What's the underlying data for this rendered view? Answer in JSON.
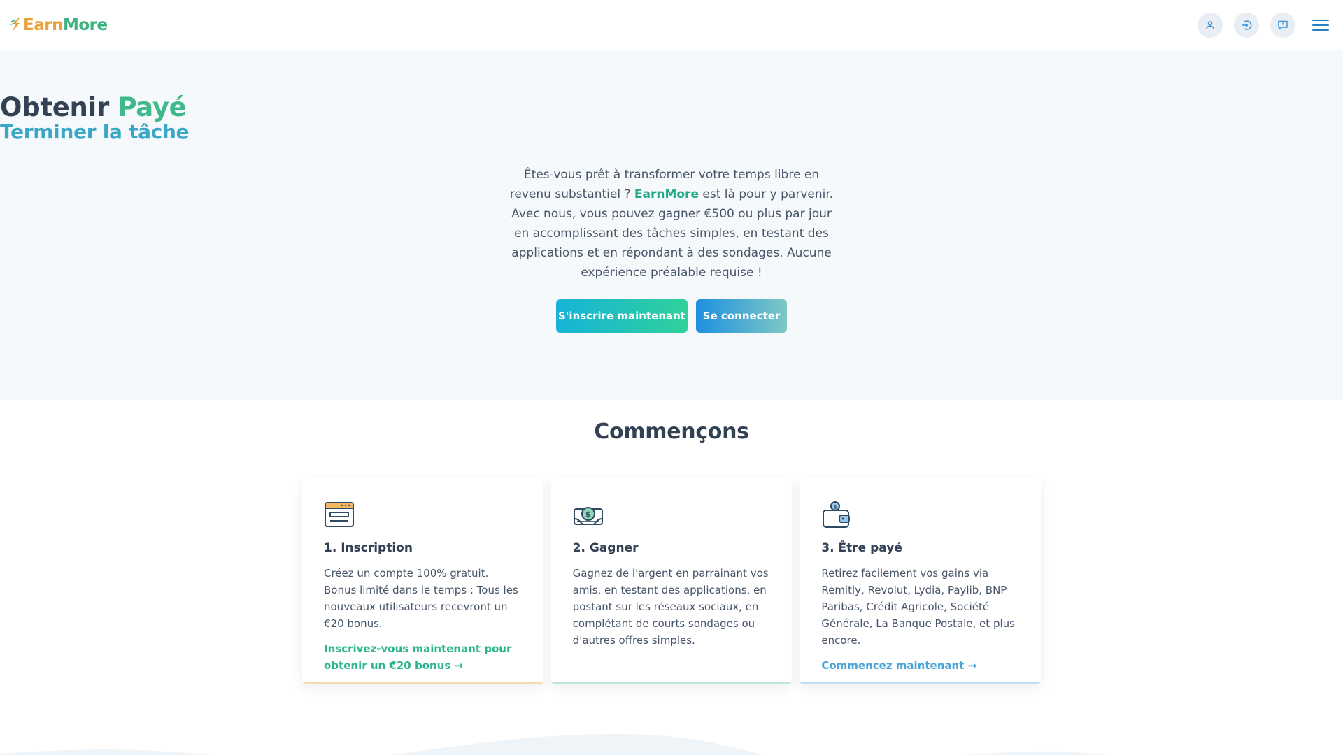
{
  "header": {
    "logo": {
      "part1": "Earn",
      "part2": "More"
    },
    "icons": [
      "user-icon",
      "login-icon",
      "help-chat-icon",
      "menu-icon"
    ]
  },
  "hero": {
    "title_part1": "Obtenir ",
    "title_accent": "Payé",
    "subtitle": "Terminer la tâche",
    "desc_part1": "Êtes-vous prêt à transformer votre temps libre en revenu substantiel ? ",
    "desc_brand": "EarnMore",
    "desc_part2": " est là pour y parvenir. Avec nous, vous pouvez gagner €500 ou plus par jour en accomplissant des tâches simples, en testant des applications et en répondant à des sondages. Aucune expérience préalable requise !",
    "signup_label": "S'inscrire maintenant",
    "login_label": "Se connecter"
  },
  "section": {
    "title": "Commençons",
    "cards": [
      {
        "icon": "browser-window-icon",
        "title": "1. Inscription",
        "text": "Créez un compte 100% gratuit. Bonus limité dans le temps : Tous les nouveaux utilisateurs recevront un €20 bonus.",
        "link": "Inscrivez-vous maintenant pour obtenir un €20 bonus →",
        "bar_color": "#f7d9a8"
      },
      {
        "icon": "money-stack-icon",
        "title": "2. Gagner",
        "text": "Gagnez de l'argent en parrainant vos amis, en testant des applications, en postant sur les réseaux sociaux, en complétant de courts sondages ou d'autres offres simples.",
        "link": "",
        "bar_color": "#bfe7d6"
      },
      {
        "icon": "wallet-coin-icon",
        "title": "3. Être payé",
        "text": "Retirez facilement vos gains via Remitly, Revolut, Lydia, Paylib, BNP Paribas, Crédit Agricole, Société Générale, La Banque Postale, et plus encore.",
        "link": "Commencez maintenant →",
        "bar_color": "#c5def5"
      }
    ]
  },
  "colors": {
    "brand_green": "#3fb98a",
    "brand_blue": "#3aa7c7",
    "logo_orange": "#e9a23b"
  }
}
